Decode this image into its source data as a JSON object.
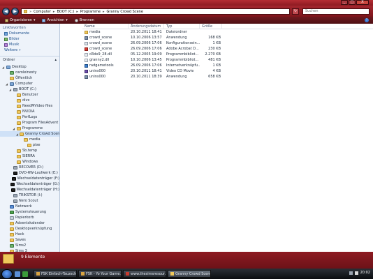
{
  "window": {
    "controls": [
      "_",
      "□",
      "X"
    ]
  },
  "address": {
    "segments": [
      "Computer",
      "BOOT (C:)",
      "Programme",
      "Granny Crowd Scene"
    ],
    "search_placeholder": "Suchen"
  },
  "toolbar": {
    "organize": "Organisieren",
    "views": "Ansichten",
    "burn": "Brennen",
    "help": "?"
  },
  "navpane": {
    "favorites_head": "Linkfavoriten",
    "favorites": [
      {
        "label": "Dokumente",
        "icon": "documents-icon"
      },
      {
        "label": "Bilder",
        "icon": "pictures-icon"
      },
      {
        "label": "Musik",
        "icon": "music-icon"
      }
    ],
    "more": "Weitere »",
    "folders_head": "Ordner",
    "tree": [
      {
        "label": "Desktop",
        "indent": 0,
        "icon": "comp",
        "exp": "◢"
      },
      {
        "label": "caroleinesty",
        "indent": 1,
        "icon": "user",
        "exp": ""
      },
      {
        "label": "Öffentlich",
        "indent": 1,
        "icon": "folder",
        "exp": ""
      },
      {
        "label": "Computer",
        "indent": 1,
        "icon": "comp",
        "exp": "◢"
      },
      {
        "label": "BOOT (C:)",
        "indent": 2,
        "icon": "drive",
        "exp": "◢"
      },
      {
        "label": "Benutzer",
        "indent": 3,
        "icon": "folder",
        "exp": ""
      },
      {
        "label": "divx",
        "indent": 3,
        "icon": "folder",
        "exp": ""
      },
      {
        "label": "NeedMVideo files",
        "indent": 3,
        "icon": "folder",
        "exp": ""
      },
      {
        "label": "NVIDIA",
        "indent": 3,
        "icon": "folder",
        "exp": ""
      },
      {
        "label": "PerfLogs",
        "indent": 3,
        "icon": "folder",
        "exp": ""
      },
      {
        "label": "Program FilesAdvent",
        "indent": 3,
        "icon": "folder",
        "exp": ""
      },
      {
        "label": "Programme",
        "indent": 3,
        "icon": "folder",
        "exp": "◢"
      },
      {
        "label": "Granny Crowd Scene",
        "indent": 4,
        "icon": "folder",
        "exp": "◢",
        "selected": true
      },
      {
        "label": "media",
        "indent": 5,
        "icon": "folder",
        "exp": ""
      },
      {
        "label": "pixe",
        "indent": 6,
        "icon": "folder",
        "exp": ""
      },
      {
        "label": "Sb.temp",
        "indent": 3,
        "icon": "folder",
        "exp": ""
      },
      {
        "label": "SIERRA",
        "indent": 3,
        "icon": "folder",
        "exp": ""
      },
      {
        "label": "Windows",
        "indent": 3,
        "icon": "folder",
        "exp": ""
      },
      {
        "label": "RECOVER (D:)",
        "indent": 2,
        "icon": "drive",
        "exp": ""
      },
      {
        "label": "DVD-RW-Laufwerk (E:)",
        "indent": 2,
        "icon": "black",
        "exp": ""
      },
      {
        "label": "Wechseldatenträger (F:)",
        "indent": 2,
        "icon": "black",
        "exp": ""
      },
      {
        "label": "Wechseldatenträger (G:)",
        "indent": 2,
        "icon": "black",
        "exp": ""
      },
      {
        "label": "Wechseldatenträger (H:)",
        "indent": 2,
        "icon": "black",
        "exp": ""
      },
      {
        "label": "TRIKSTOR (I:)",
        "indent": 2,
        "icon": "drive",
        "exp": ""
      },
      {
        "label": "Nero Scout",
        "indent": 2,
        "icon": "drive",
        "exp": ""
      },
      {
        "label": "Netzwerk",
        "indent": 1,
        "icon": "net",
        "exp": ""
      },
      {
        "label": "Systemsteuerung",
        "indent": 1,
        "icon": "ctrl",
        "exp": ""
      },
      {
        "label": "Papierkorb",
        "indent": 1,
        "icon": "trash",
        "exp": ""
      },
      {
        "label": "Adventskalender",
        "indent": 1,
        "icon": "folder",
        "exp": ""
      },
      {
        "label": "Desktopverknüpfung",
        "indent": 1,
        "icon": "folder",
        "exp": ""
      },
      {
        "label": "Hack",
        "indent": 1,
        "icon": "folder",
        "exp": ""
      },
      {
        "label": "Saves",
        "indent": 1,
        "icon": "folder",
        "exp": ""
      },
      {
        "label": "Sims2",
        "indent": 1,
        "icon": "user",
        "exp": ""
      },
      {
        "label": "Sims 3",
        "indent": 1,
        "icon": "folder",
        "exp": ""
      }
    ]
  },
  "files": {
    "columns": [
      "Name",
      "Änderungsdatum",
      "Typ",
      "Größe"
    ],
    "rows": [
      {
        "name": "media",
        "date": "20.10.2011 18:41",
        "type": "Dateiordner",
        "size": "",
        "icon": "folder"
      },
      {
        "name": "crowd_scene",
        "date": "10.10.2006 13:57",
        "type": "Anwendung",
        "size": "168 KB",
        "icon": "app"
      },
      {
        "name": "crowd_scene",
        "date": "26.09.2006 17:06",
        "type": "Konfigurationsein...",
        "size": "1 KB",
        "icon": "cfg"
      },
      {
        "name": "crowd_scene",
        "date": "26.09.2006 17:06",
        "type": "Adobe Acrobat D...",
        "size": "230 KB",
        "icon": "pdf"
      },
      {
        "name": "d3dx9_28.dll",
        "date": "05.12.2005 19:09",
        "type": "Programmbibliot...",
        "size": "2.270 KB",
        "icon": "dll"
      },
      {
        "name": "granny2.dll",
        "date": "10.10.2006 13:45",
        "type": "Programmbibliot...",
        "size": "481 KB",
        "icon": "dll"
      },
      {
        "name": "radgametools",
        "date": "26.09.2006 17:06",
        "type": "Internetverknüpfu...",
        "size": "1 KB",
        "icon": "url"
      },
      {
        "name": "unins000",
        "date": "20.10.2011 18:41",
        "type": "Video CD Movie",
        "size": "4 KB",
        "icon": "vcd"
      },
      {
        "name": "unins000",
        "date": "20.10.2011 18:39",
        "type": "Anwendung",
        "size": "658 KB",
        "icon": "app"
      }
    ]
  },
  "details": {
    "count_text": "9 Elemente"
  },
  "taskbar": {
    "tasks": [
      {
        "label": "FSK Einfach-Tauzsch...",
        "icon_color": "#d9a441",
        "active": false
      },
      {
        "label": "FSK - Yo Your Game...",
        "icon_color": "#d9a441",
        "active": false
      },
      {
        "label": "www.thesimsresour...",
        "icon_color": "#c83a2e",
        "active": false
      },
      {
        "label": "Granny Crowd Scene",
        "icon_color": "#f0c85a",
        "active": true
      }
    ],
    "clock": "20:02"
  }
}
